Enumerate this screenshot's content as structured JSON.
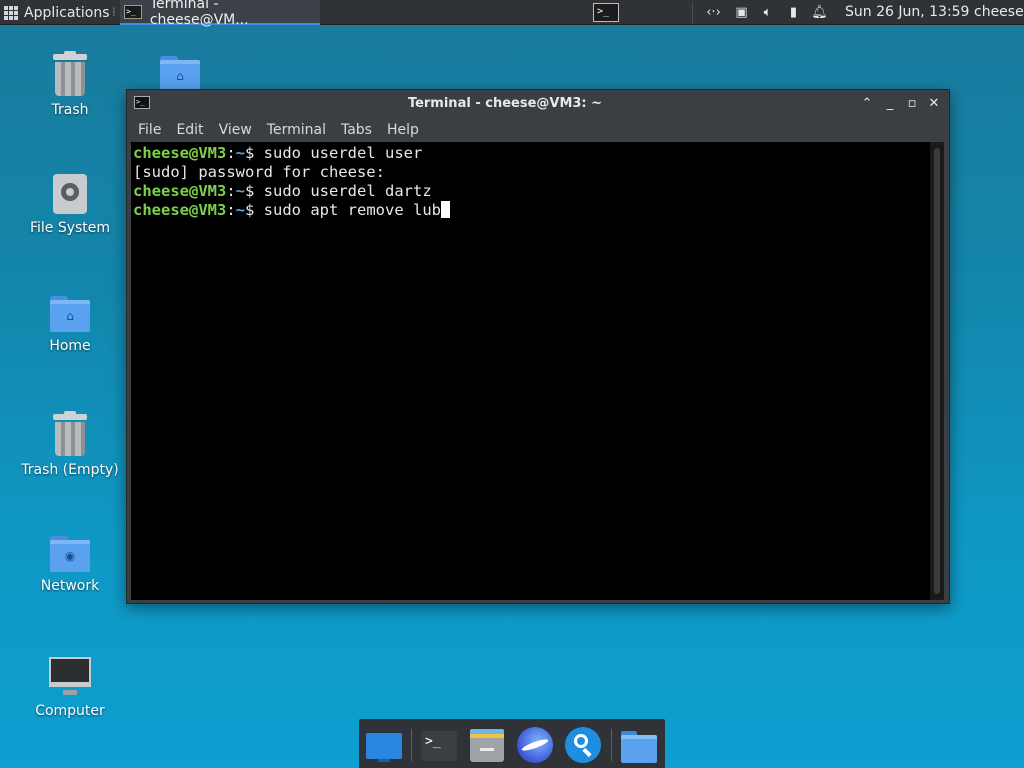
{
  "top_panel": {
    "applications_label": "Applications",
    "task_title": "Terminal - cheese@VM...",
    "clock": "Sun 26 Jun, 13:59",
    "user": "cheese",
    "tray_icons": [
      "network-icon",
      "display-icon",
      "volume-icon",
      "battery-icon",
      "notification-bell-icon"
    ]
  },
  "desktop_icons": [
    {
      "label": "Trash",
      "icon": "trash-icon"
    },
    {
      "label": "File System",
      "icon": "drive-icon"
    },
    {
      "label": "Home",
      "icon": "home-folder-icon"
    },
    {
      "label": "Trash (Empty)",
      "icon": "trash-icon"
    },
    {
      "label": "Network",
      "icon": "network-folder-icon"
    },
    {
      "label": "Computer",
      "icon": "computer-icon"
    }
  ],
  "terminal": {
    "title": "Terminal - cheese@VM3: ~",
    "menu": [
      "File",
      "Edit",
      "View",
      "Terminal",
      "Tabs",
      "Help"
    ],
    "lines": [
      {
        "user": "cheese@VM3",
        "sep": ":",
        "path": "~",
        "cmd": "$ sudo userdel user"
      },
      {
        "text": "[sudo] password for cheese:"
      },
      {
        "user": "cheese@VM3",
        "sep": ":",
        "path": "~",
        "cmd": "$ sudo userdel dartz"
      },
      {
        "user": "cheese@VM3",
        "sep": ":",
        "path": "~",
        "cmd": "$ sudo apt remove lub"
      }
    ]
  },
  "dock": [
    "show-desktop-icon",
    "terminal-icon",
    "file-manager-icon",
    "web-browser-icon",
    "app-finder-icon",
    "folder-icon"
  ]
}
